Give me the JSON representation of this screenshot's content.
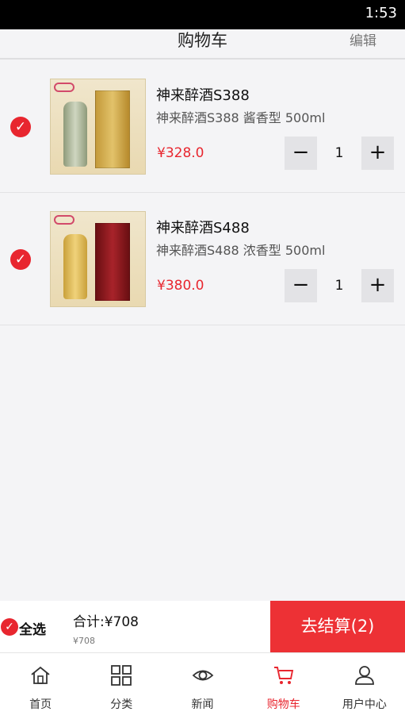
{
  "status_bar": {
    "time": "1:53"
  },
  "header": {
    "title": "购物车",
    "edit_label": "编辑"
  },
  "cart": {
    "items": [
      {
        "name": "神来醉酒S388",
        "spec": "神来醉酒S388 酱香型 500ml",
        "price": "¥328.0",
        "quantity": "1",
        "checked": true
      },
      {
        "name": "神来醉酒S488",
        "spec": "神来醉酒S488 浓香型 500ml",
        "price": "¥380.0",
        "quantity": "1",
        "checked": true
      }
    ],
    "minus_label": "−",
    "plus_label": "+"
  },
  "checkout_bar": {
    "select_all_label": "全选",
    "total_label": "合计:¥708",
    "total_sub": "¥708",
    "checkout_button": "去结算(2)"
  },
  "tab_bar": {
    "tabs": [
      {
        "label": "首页",
        "icon": "home-icon",
        "active": false
      },
      {
        "label": "分类",
        "icon": "grid-icon",
        "active": false
      },
      {
        "label": "新闻",
        "icon": "eye-icon",
        "active": false
      },
      {
        "label": "购物车",
        "icon": "cart-icon",
        "active": true
      },
      {
        "label": "用户中心",
        "icon": "user-icon",
        "active": false
      }
    ]
  },
  "colors": {
    "accent": "#e8262f",
    "checkout_bg": "#ed3135"
  }
}
